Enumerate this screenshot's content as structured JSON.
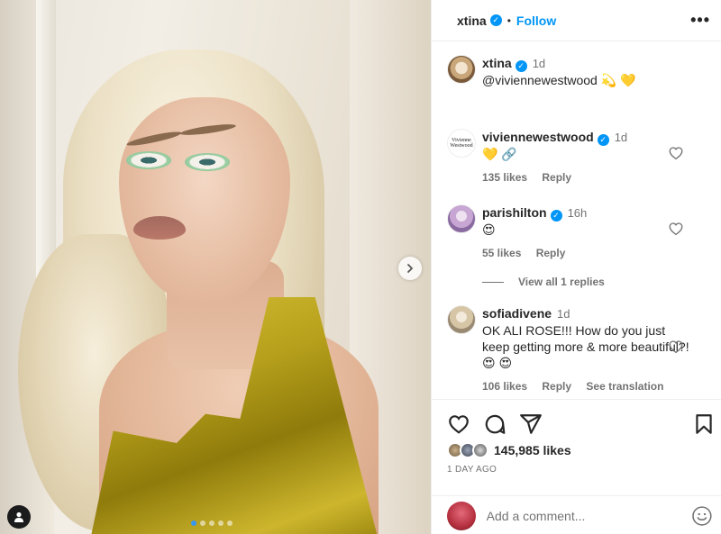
{
  "post": {
    "author": "xtina",
    "follow_label": "Follow",
    "separator": "•",
    "more_label": "•••"
  },
  "caption": {
    "user": "xtina",
    "time": "1d",
    "text": "@viviennewestwood 💫 💛"
  },
  "comments": [
    {
      "user": "viviennewestwood",
      "verified": true,
      "time": "1d",
      "text": "💛 🔗",
      "likes": "135 likes",
      "reply": "Reply"
    },
    {
      "user": "parishilton",
      "verified": true,
      "time": "16h",
      "text": "😍",
      "likes": "55 likes",
      "reply": "Reply",
      "view_replies": "View all 1 replies"
    },
    {
      "user": "sofiadivene",
      "verified": false,
      "time": "1d",
      "text": "OK ALI ROSE!!! How do you just keep getting more & more beautiful?! 😍 😍",
      "likes": "106 likes",
      "reply": "Reply",
      "translation": "See translation"
    }
  ],
  "vivienne_logo_text": "Vivienne Westwood",
  "engagement": {
    "likes": "145,985 likes",
    "date": "1 DAY AGO"
  },
  "composer": {
    "placeholder": "Add a comment..."
  },
  "carousel": {
    "slides": 5,
    "active_index": 0
  },
  "colors": {
    "accent": "#0095f6",
    "muted": "#737373",
    "dress": "#b7a11c"
  },
  "icons": [
    "heart-icon",
    "comment-icon",
    "share-icon",
    "bookmark-icon",
    "emoji-icon",
    "chevron-right-icon",
    "tag-user-icon"
  ]
}
